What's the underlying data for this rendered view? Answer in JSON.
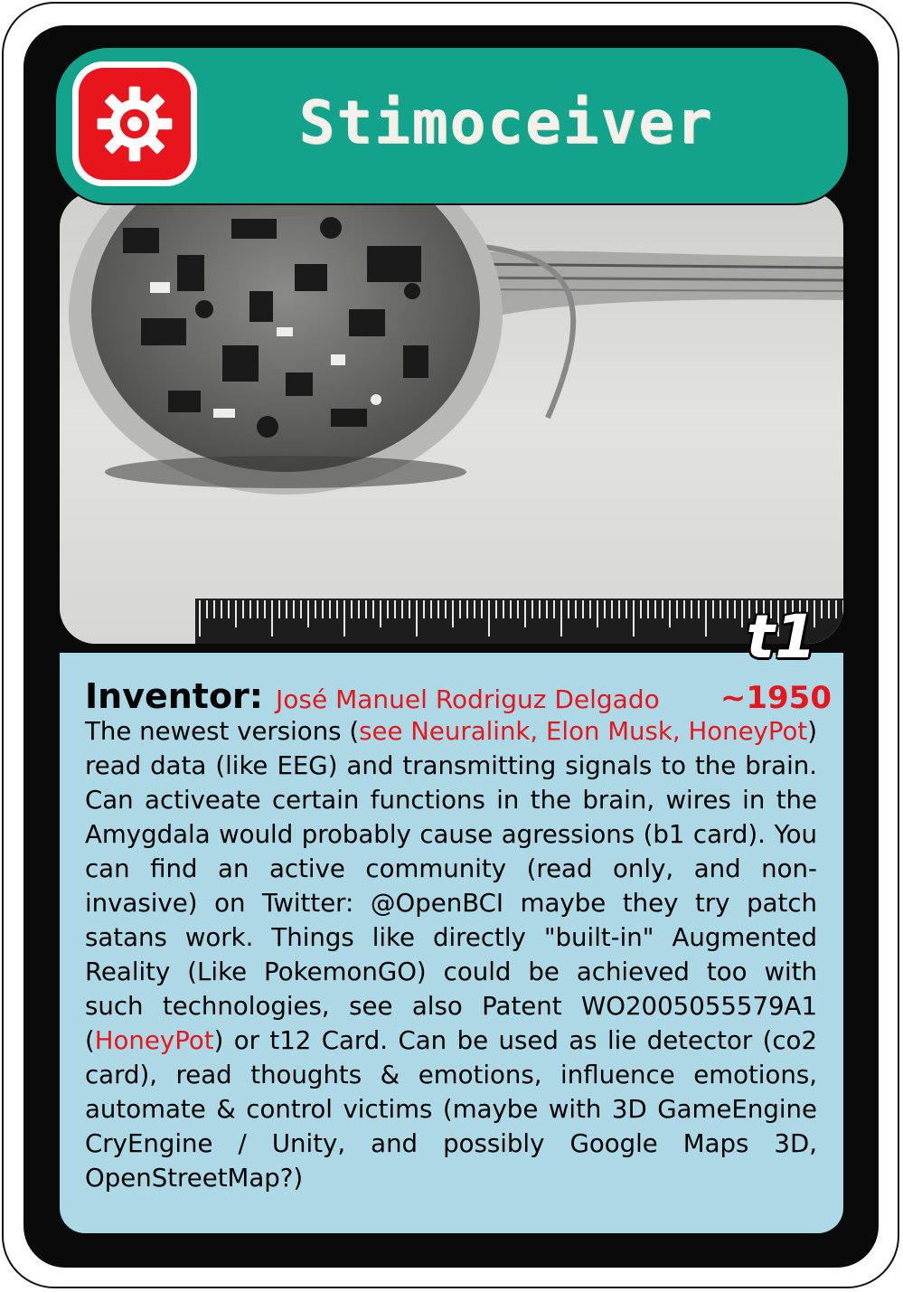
{
  "card": {
    "title": "Stimoceiver",
    "icon": "gear-icon",
    "tag": "t1",
    "inventor_label": "Inventor:",
    "inventor_name": "José Manuel Rodriguz Delgado",
    "year": "~1950",
    "colors": {
      "header": "#12a38a",
      "icon_bg": "#e8161c",
      "info_bg": "#add8e6",
      "highlight": "#e8161c"
    }
  },
  "description": {
    "t1": "The newest versions (",
    "r1": "see Neuralink, Elon Musk, HoneyPot",
    "t2": ") read data (like EEG) and transmitting signals to the brain. Can activeate certain functions in the brain, wires in the Amygdala would probably cause agressions (b1 card). You can find an active community (read only, and non-invasive) on Twitter: @OpenBCI maybe they try patch satans work. Things like directly \"built-in\" Augmented Reality (Like PokemonGO) could be achieved too with such technologies, see also Patent WO2005055579A1 (",
    "r2": "HoneyPot",
    "t3": ") or t12 Card. Can be used as lie detector (co2 card), read thoughts & emotions, influence emotions, automate & control victims (maybe with 3D GameEngine CryEngine / Unity, and possibly Google Maps 3D, OpenStreetMap?)"
  }
}
